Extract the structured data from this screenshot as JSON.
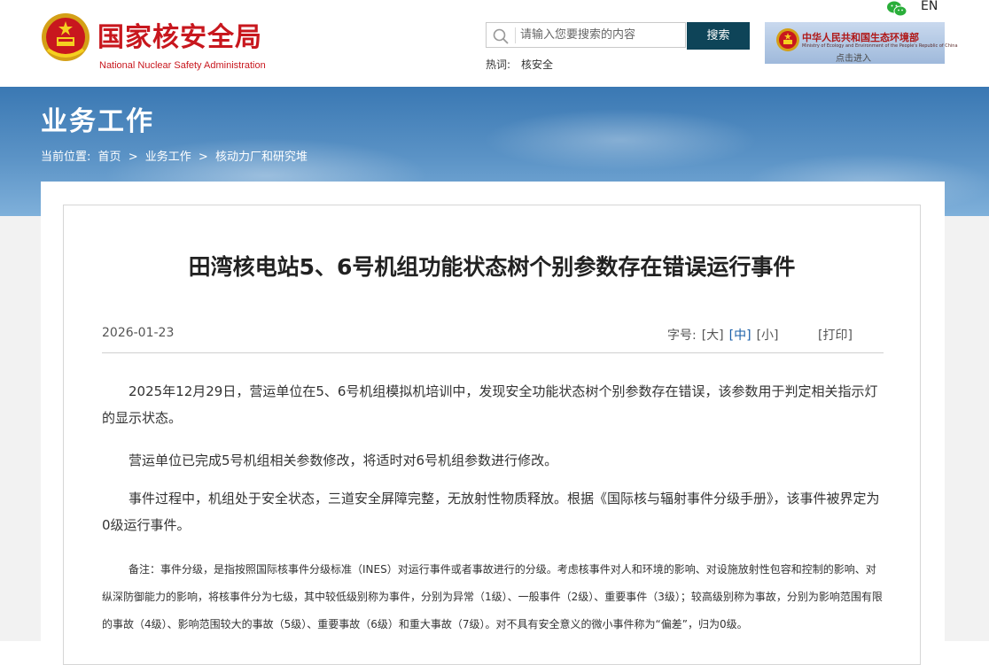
{
  "header": {
    "logo_cn": "国家核安全局",
    "logo_en": "National Nuclear Safety Administration",
    "search_placeholder": "请输入您要搜索的内容",
    "search_button": "搜索",
    "hot_label": "热词:",
    "hot_words": [
      "核安全"
    ],
    "mee_banner": {
      "title": "中华人民共和国生态环境部",
      "subtitle": "Ministry of Ecology and Environment of the People's Republic of China",
      "enter": "点击进入"
    },
    "lang_switch": "EN"
  },
  "banner": {
    "title": "业务工作",
    "breadcrumb": [
      "当前位置:",
      "首页",
      ">",
      "业务工作",
      ">",
      "核动力厂和研究堆"
    ]
  },
  "article": {
    "title": "田湾核电站5、6号机组功能状态树个别参数存在错误运行事件",
    "date": "2026-01-23",
    "font_size_label": "字号:",
    "font_options": [
      "[大]",
      "[中]",
      "[小]"
    ],
    "active_font_option": "[中]",
    "print_label": "[打印]",
    "paragraphs": [
      "2025年12月29日，营运单位在5、6号机组模拟机培训中，发现安全功能状态树个别参数存在错误，该参数用于判定相关指示灯的显示状态。",
      "营运单位已完成5号机组相关参数修改，将适时对6号机组参数进行修改。",
      "事件过程中，机组处于安全状态，三道安全屏障完整，无放射性物质释放。根据《国际核与辐射事件分级手册》，该事件被界定为0级运行事件。"
    ],
    "note": "备注：事件分级，是指按照国际核事件分级标准（INES）对运行事件或者事故进行的分级。考虑核事件对人和环境的影响、对设施放射性包容和控制的影响、对纵深防御能力的影响，将核事件分为七级，其中较低级别称为事件，分别为异常（1级）、一般事件（2级）、重要事件（3级）；较高级别称为事故，分别为影响范围有限的事故（4级）、影响范围较大的事故（5级）、重要事故（6级）和重大事故（7级）。对不具有安全意义的微小事件称为“偏差”，归为0级。"
  },
  "colors": {
    "brand_red": "#c8171e",
    "search_button_bg": "#0e4458",
    "banner_blue": "#5b93c6",
    "active_link": "#1a5fa8"
  }
}
